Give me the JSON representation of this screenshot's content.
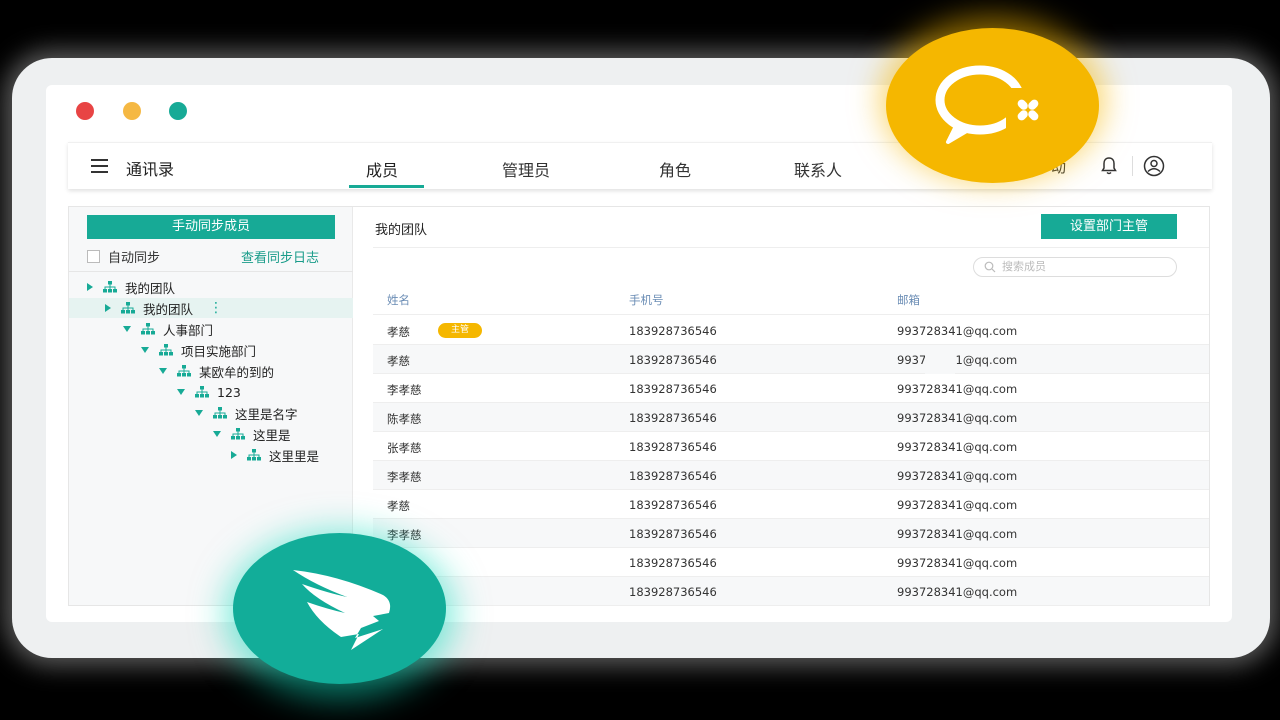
{
  "app": {
    "title": "通讯录",
    "tabs": [
      "成员",
      "管理员",
      "角色",
      "联系人"
    ],
    "active_tab": "成员",
    "partial_tab_text": "动"
  },
  "sidebar": {
    "sync_button": "手动同步成员",
    "auto_sync_label": "自动同步",
    "sync_log_link": "查看同步日志",
    "tree": [
      {
        "label": "我的团队",
        "expanded": false,
        "depth": 0
      },
      {
        "label": "我的团队",
        "expanded": false,
        "depth": 1,
        "selected": true
      },
      {
        "label": "人事部门",
        "expanded": true,
        "depth": 2
      },
      {
        "label": "项目实施部门",
        "expanded": true,
        "depth": 3
      },
      {
        "label": "某欧牟的到的",
        "expanded": true,
        "depth": 4
      },
      {
        "label": "123",
        "expanded": true,
        "depth": 5
      },
      {
        "label": "这里是名字",
        "expanded": true,
        "depth": 6
      },
      {
        "label": "这里是",
        "expanded": true,
        "depth": 7
      },
      {
        "label": "这里里是",
        "expanded": false,
        "depth": 8
      }
    ]
  },
  "main": {
    "title": "我的团队",
    "set_head_button": "设置部门主管",
    "search_placeholder": "搜索成员",
    "columns": [
      "姓名",
      "手机号",
      "邮箱"
    ],
    "badge_label": "主管",
    "rows": [
      {
        "name": "孝慈",
        "phone": "183928736546",
        "email": "993728341@qq.com",
        "badge": true
      },
      {
        "name": "孝慈",
        "phone": "183928736546",
        "email": "993728341@qq.com"
      },
      {
        "name": "李孝慈",
        "phone": "183928736546",
        "email": "993728341@qq.com"
      },
      {
        "name": "陈孝慈",
        "phone": "183928736546",
        "email": "993728341@qq.com"
      },
      {
        "name": "张孝慈",
        "phone": "183928736546",
        "email": "993728341@qq.com"
      },
      {
        "name": "李孝慈",
        "phone": "183928736546",
        "email": "993728341@qq.com"
      },
      {
        "name": "孝慈",
        "phone": "183928736546",
        "email": "993728341@qq.com"
      },
      {
        "name": "李孝慈",
        "phone": "183928736546",
        "email": "993728341@qq.com"
      },
      {
        "name": "李孝慈",
        "phone": "183928736546",
        "email": "993728341@qq.com"
      },
      {
        "name": "",
        "phone": "183928736546",
        "email": "993728341@qq.com"
      }
    ]
  },
  "colors": {
    "accent": "#17aa96",
    "badge": "#f5b700",
    "wecom": "#f5b700",
    "dingtalk": "#12ad99"
  },
  "icons": [
    "menu-icon",
    "bell-icon",
    "user-icon",
    "search-icon",
    "org-icon",
    "wecom-logo",
    "dingtalk-logo"
  ]
}
